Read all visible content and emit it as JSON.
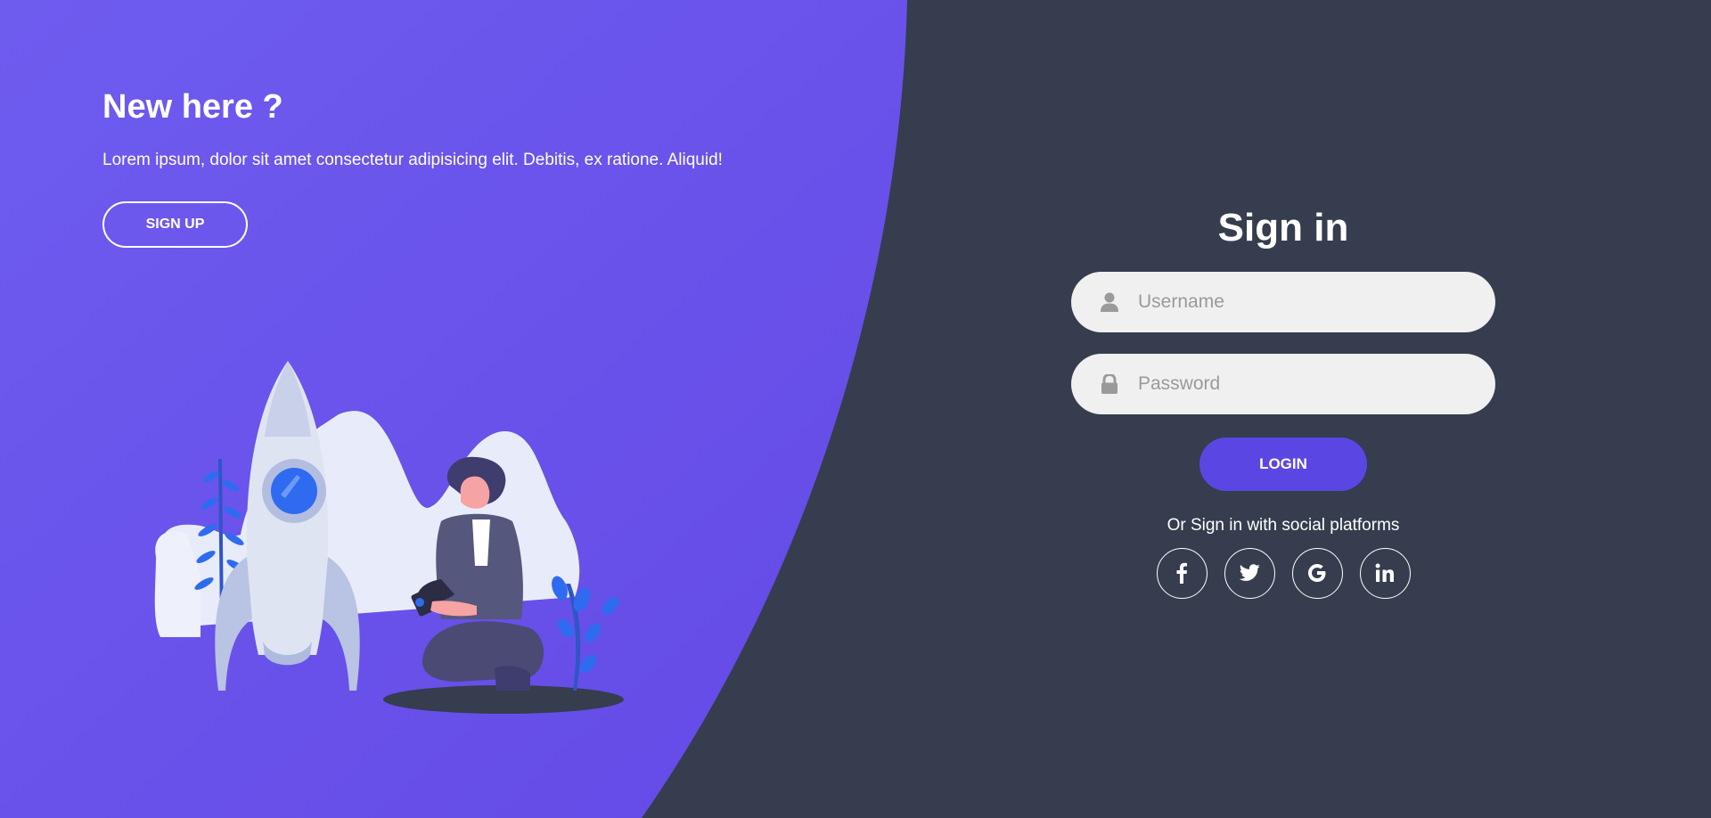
{
  "colors": {
    "primary": "#6c5ce7",
    "background": "#353d4e",
    "field": "#f0f0f0",
    "login": "#5a47e3"
  },
  "left": {
    "title": "New here ?",
    "text": "Lorem ipsum, dolor sit amet consectetur adipisicing elit. Debitis, ex ratione. Aliquid!",
    "signup_label": "SIGN UP"
  },
  "signin": {
    "title": "Sign in",
    "username": {
      "placeholder": "Username",
      "value": "",
      "icon": "user-icon"
    },
    "password": {
      "placeholder": "Password",
      "value": "",
      "icon": "lock-icon"
    },
    "login_label": "LOGIN",
    "social_text": "Or Sign in with social platforms",
    "social": [
      {
        "name": "facebook",
        "glyph": "f"
      },
      {
        "name": "twitter",
        "glyph": "twitter-bird"
      },
      {
        "name": "google",
        "glyph": "G"
      },
      {
        "name": "linkedin",
        "glyph": "in"
      }
    ]
  }
}
